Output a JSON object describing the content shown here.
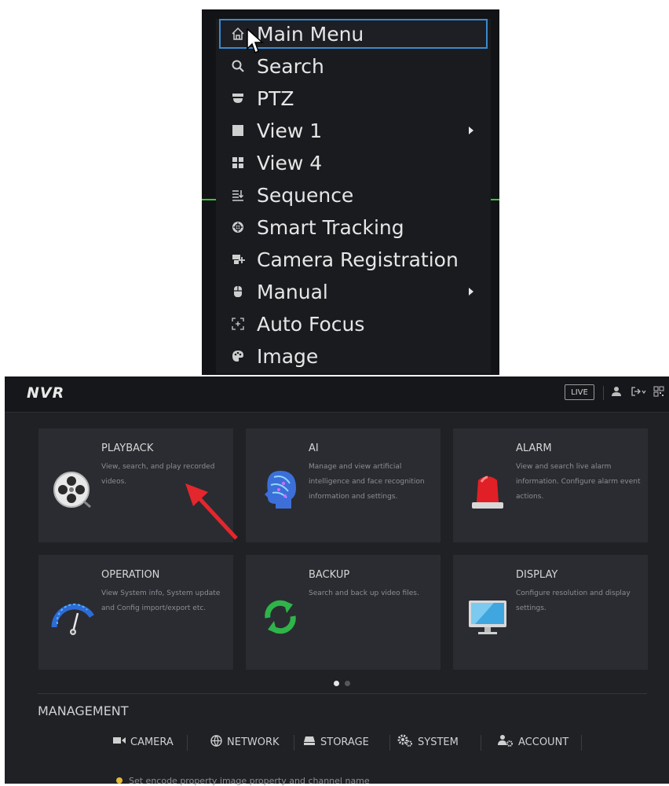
{
  "context_menu": {
    "items": [
      {
        "label": "Main Menu",
        "icon": "home-icon",
        "selected": true,
        "submenu": false
      },
      {
        "label": "Search",
        "icon": "search-icon",
        "selected": false,
        "submenu": false
      },
      {
        "label": "PTZ",
        "icon": "ptz-dome-icon",
        "selected": false,
        "submenu": false
      },
      {
        "label": "View 1",
        "icon": "single-view-icon",
        "selected": false,
        "submenu": true
      },
      {
        "label": "View 4",
        "icon": "quad-view-icon",
        "selected": false,
        "submenu": false
      },
      {
        "label": "Sequence",
        "icon": "sequence-icon",
        "selected": false,
        "submenu": false
      },
      {
        "label": "Smart Tracking",
        "icon": "tracking-icon",
        "selected": false,
        "submenu": false
      },
      {
        "label": "Camera Registration",
        "icon": "camera-registration-icon",
        "selected": false,
        "submenu": false
      },
      {
        "label": "Manual",
        "icon": "mouse-icon",
        "selected": false,
        "submenu": true
      },
      {
        "label": "Auto Focus",
        "icon": "focus-icon",
        "selected": false,
        "submenu": false
      },
      {
        "label": "Image",
        "icon": "palette-icon",
        "selected": false,
        "submenu": false
      }
    ]
  },
  "nvr": {
    "logo": "NVR",
    "topbar": {
      "live_label": "LIVE",
      "icons": [
        "user-icon",
        "logout-icon",
        "qr-code-icon"
      ]
    },
    "tiles": [
      {
        "title": "PLAYBACK",
        "desc": "View, search, and play recorded videos.",
        "icon": "film-reel-icon"
      },
      {
        "title": "AI",
        "desc": "Manage and view artificial intelligence and face recognition information and settings.",
        "icon": "ai-head-icon"
      },
      {
        "title": "ALARM",
        "desc": "View and search live alarm information. Configure alarm event actions.",
        "icon": "alarm-siren-icon"
      },
      {
        "title": "OPERATION",
        "desc": "View System info, System update and Config import/export etc.",
        "icon": "gauge-icon"
      },
      {
        "title": "BACKUP",
        "desc": "Search and back up video files.",
        "icon": "refresh-arrows-icon"
      },
      {
        "title": "DISPLAY",
        "desc": "Configure resolution and display settings.",
        "icon": "monitor-icon"
      }
    ],
    "pager": {
      "current": 1,
      "total": 2
    },
    "management": {
      "title": "MANAGEMENT",
      "tabs": [
        {
          "label": "CAMERA",
          "icon": "video-camera-icon"
        },
        {
          "label": "NETWORK",
          "icon": "network-globe-icon"
        },
        {
          "label": "STORAGE",
          "icon": "storage-icon"
        },
        {
          "label": "SYSTEM",
          "icon": "gears-icon"
        },
        {
          "label": "ACCOUNT",
          "icon": "account-icon"
        }
      ],
      "hint": "Set encode property image property and channel name"
    },
    "colors": {
      "accent_green": "#35c93a",
      "selection_blue": "#3a8ad0",
      "annotation_red": "#e4262d"
    }
  }
}
